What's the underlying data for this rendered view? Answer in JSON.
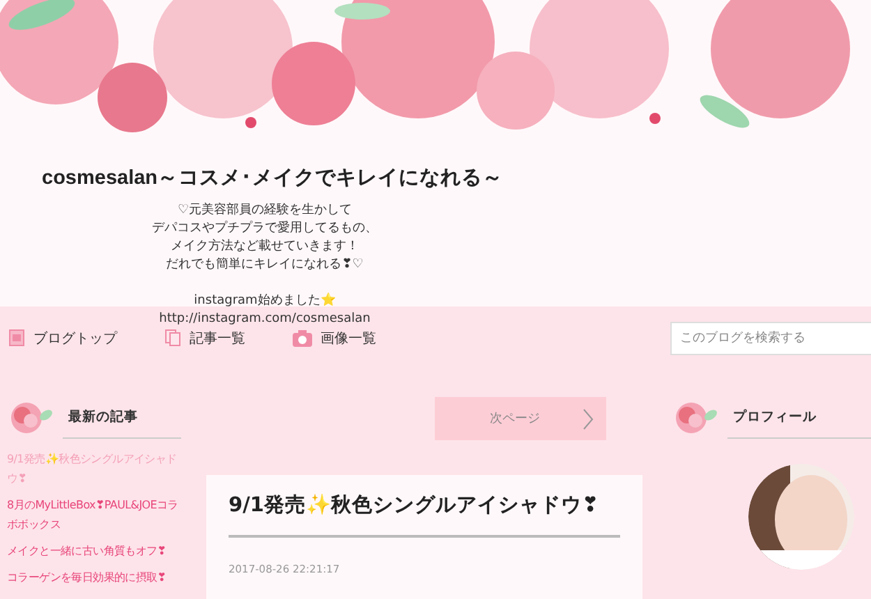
{
  "header": {
    "title": "cosmesalan～コスメ･メイクでキレイになれる～",
    "description": [
      "♡元美容部員の経験を生かして",
      "デパコスやプチプラで愛用してるもの、",
      "メイク方法など載せていきます！",
      "だれでも簡単にキレイになれる❣♡"
    ],
    "instagram": [
      "instagram始めました⭐",
      "http://instagram.com/cosmesalan"
    ]
  },
  "nav": {
    "items": [
      {
        "label": "ブログトップ"
      },
      {
        "label": "記事一覧"
      },
      {
        "label": "画像一覧"
      }
    ],
    "search": {
      "placeholder": "このブログを検索する"
    }
  },
  "latest": {
    "title": "最新の記事",
    "items": [
      {
        "label": "9/1発売✨秋色シングルアイシャドウ❣",
        "selected": true
      },
      {
        "label": "8月のMyLittleBox❣PAUL&JOEコラボボックス",
        "selected": false
      },
      {
        "label": "メイクと一緒に古い角質もオフ❣",
        "selected": false
      },
      {
        "label": "コラーゲンを毎日効果的に摂取❣",
        "selected": false
      }
    ]
  },
  "pager": {
    "next": "次ページ"
  },
  "article": {
    "title": "9/1発売✨秋色シングルアイシャドウ❣",
    "date": "2017-08-26 22:21:17"
  },
  "profile": {
    "title": "プロフィール"
  }
}
